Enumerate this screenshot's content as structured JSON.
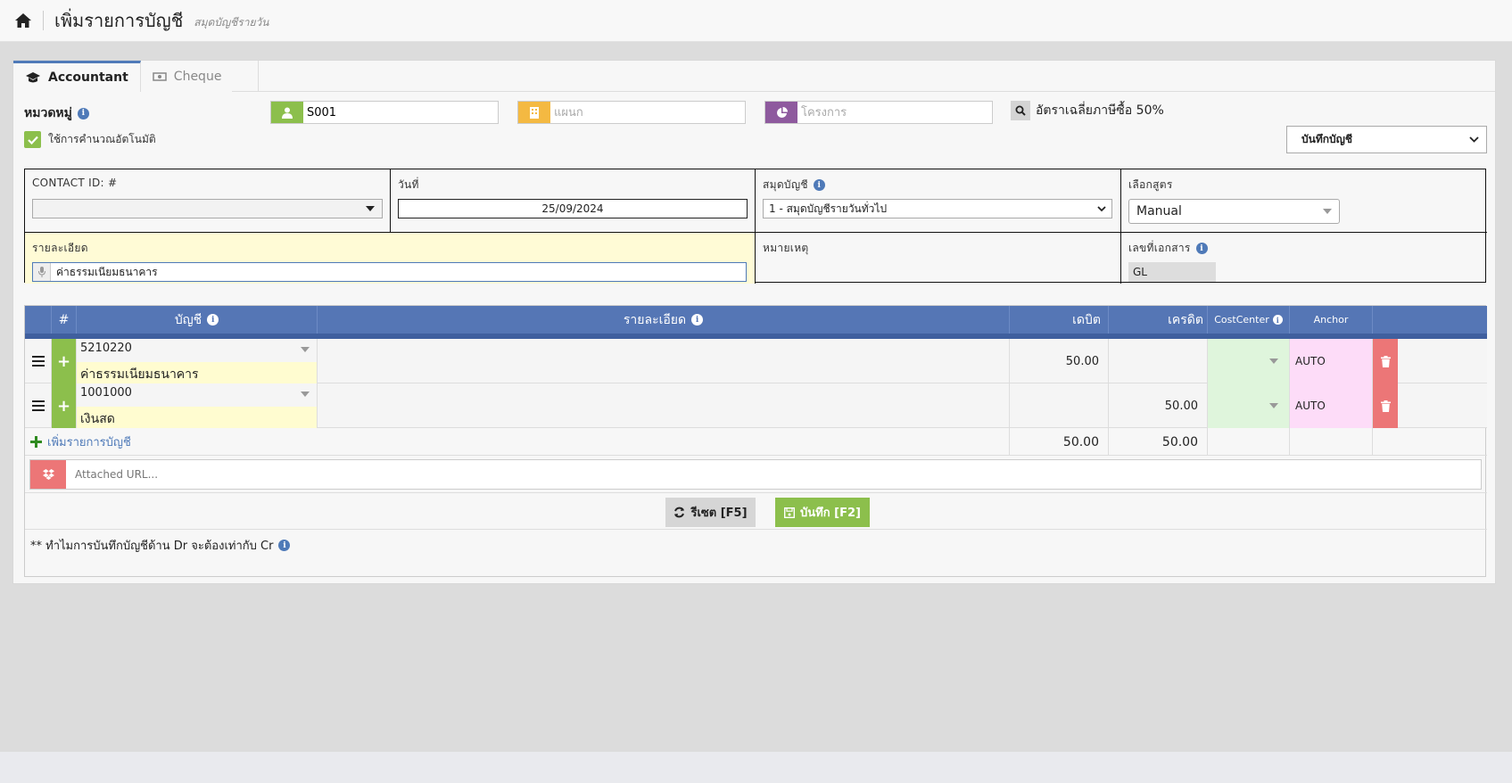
{
  "header": {
    "title": "เพิ่มรายการบัญชี",
    "subtitle": "สมุดบัญชีรายวัน"
  },
  "tabs": [
    {
      "label": "Accountant",
      "active": true
    },
    {
      "label": "Cheque",
      "active": false
    }
  ],
  "group": {
    "label": "หมวดหมู่",
    "auto_calc_label": "ใช้การคำนวณอัตโนมัติ",
    "auto_calc_checked": true
  },
  "filters": {
    "customer_value": "S001",
    "department_placeholder": "แผนก",
    "project_placeholder": "โครงการ",
    "vat_text": "อัตราเฉลี่ยภาษีซื้อ 50%"
  },
  "save_mode": {
    "selected": "บันทึกบัญชี"
  },
  "form": {
    "contact_label": "CONTACT ID: #",
    "date_label": "วันที่",
    "date_value": "25/09/2024",
    "journal_label": "สมุดบัญชี",
    "journal_value": "1 - สมุดบัญชีรายวันทั่วไป",
    "formula_label": "เลือกสูตร",
    "formula_value": "Manual",
    "detail_label": "รายละเอียด",
    "detail_value": "ค่าธรรมเนียมธนาคาร",
    "remark_label": "หมายเหตุ",
    "docno_label": "เลขที่เอกสาร",
    "docno_value": "GL"
  },
  "table": {
    "headers": {
      "index": "#",
      "account": "บัญชี",
      "detail": "รายละเอียด",
      "debit": "เดบิต",
      "credit": "เครดิต",
      "costcenter": "CostCenter",
      "anchor": "Anchor"
    },
    "rows": [
      {
        "code": "5210220",
        "name": "ค่าธรรมเนียมธนาคาร",
        "debit": "50.00",
        "credit": "",
        "anchor": "AUTO"
      },
      {
        "code": "1001000",
        "name": "เงินสด",
        "debit": "",
        "credit": "50.00",
        "anchor": "AUTO"
      }
    ],
    "add_label": "เพิ่มรายการบัญชี",
    "total_debit": "50.00",
    "total_credit": "50.00"
  },
  "attach": {
    "placeholder": "Attached URL..."
  },
  "buttons": {
    "reset": "รีเซต [F5]",
    "save": "บันทึก [F2]"
  },
  "note": "** ทำไมการบันทึกบัญชีด้าน Dr จะต้องเท่ากับ Cr",
  "colors": {
    "accent": "#5576b5",
    "green": "#8cbf4c",
    "yellow": "#f4b942",
    "purple": "#8e5a9e",
    "red": "#ec7677"
  }
}
